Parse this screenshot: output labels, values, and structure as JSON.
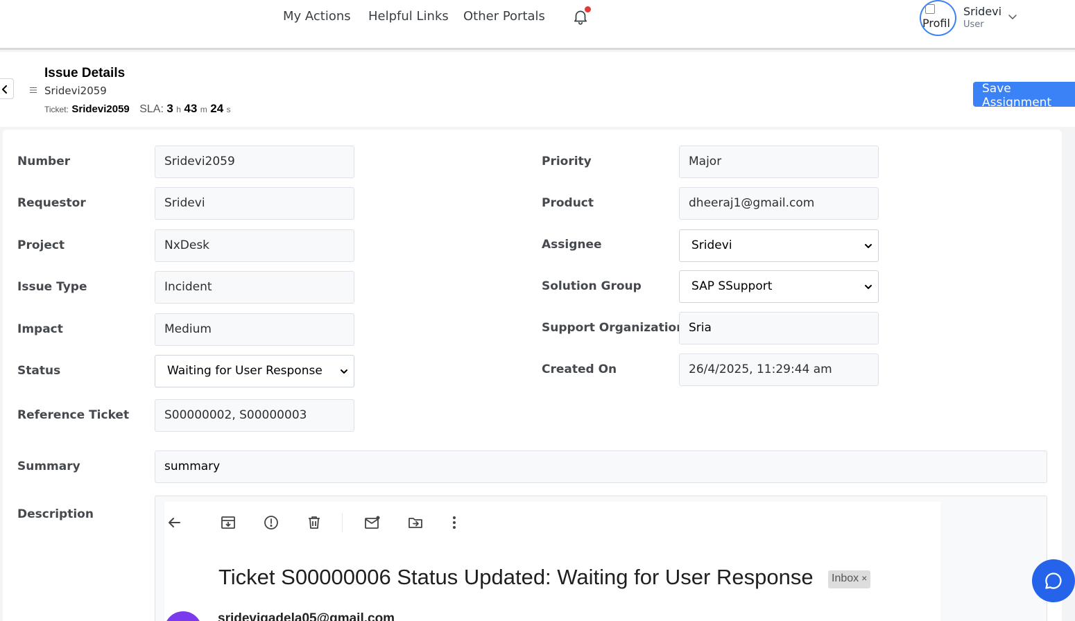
{
  "nav": {
    "links": [
      "My Actions",
      "Helpful Links",
      "Other Portals"
    ],
    "avatar_alt": "Profil",
    "user_name": "Sridevi",
    "user_role": "User"
  },
  "header": {
    "title": "Issue Details",
    "subtitle": "Sridevi2059",
    "ticket_label": "Ticket:",
    "ticket_id": "Sridevi2059",
    "sla_label": "SLA:",
    "sla_hours": "3",
    "sla_h_unit": "h",
    "sla_minutes": "43",
    "sla_m_unit": "m",
    "sla_seconds": "24",
    "sla_s_unit": "s",
    "save_button": "Save Assignment"
  },
  "form": {
    "number_label": "Number",
    "number_value": "Sridevi2059",
    "requestor_label": "Requestor",
    "requestor_value": "Sridevi",
    "project_label": "Project",
    "project_value": "NxDesk",
    "issue_type_label": "Issue Type",
    "issue_type_value": "Incident",
    "impact_label": "Impact",
    "impact_value": "Medium",
    "status_label": "Status",
    "status_value": "Waiting for User Response",
    "reference_label": "Reference Ticket",
    "reference_value": "S00000002, S00000003",
    "priority_label": "Priority",
    "priority_value": "Major",
    "product_label": "Product",
    "product_value": "dheeraj1@gmail.com",
    "assignee_label": "Assignee",
    "assignee_value": "Sridevi",
    "solution_group_label": "Solution Group",
    "solution_group_value": "SAP SSupport",
    "support_org_label": "Support Organization",
    "support_org_value": "Sria",
    "created_on_label": "Created On",
    "created_on_value": "26/4/2025, 11:29:44 am",
    "summary_label": "Summary",
    "summary_value": "summary",
    "description_label": "Description"
  },
  "description_image": {
    "subject": "Ticket S00000006 Status Updated: Waiting for User Response",
    "chip": "Inbox",
    "chip_close": "×",
    "sender": "sridevigadela05@gmail.com",
    "avatar_color": "#7c3aed"
  },
  "colors": {
    "accent": "#3b82f6",
    "notification_dot": "#e53935",
    "chat_button": "#2563eb"
  },
  "icons": [
    "bell-icon",
    "chevron-down-icon",
    "chevron-left-icon",
    "menu-icon",
    "arrow-left-icon",
    "archive-icon",
    "report-icon",
    "trash-icon",
    "mark-unread-icon",
    "move-to-icon",
    "more-vert-icon",
    "chat-icon"
  ]
}
